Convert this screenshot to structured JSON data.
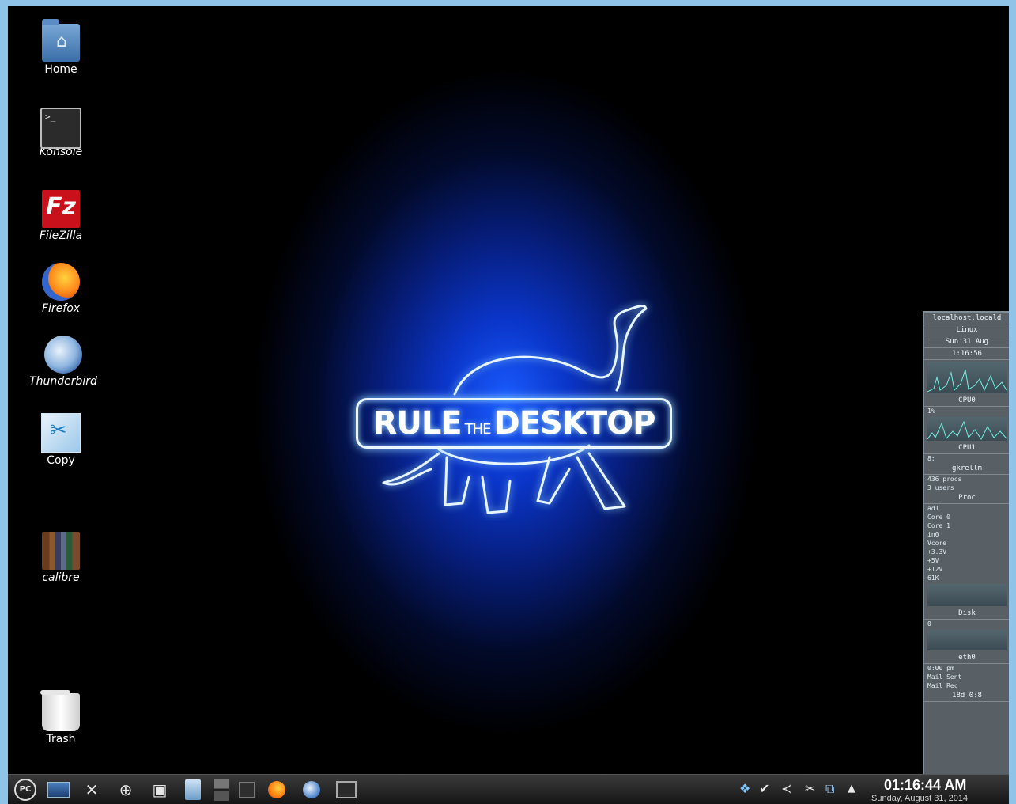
{
  "desktop_icons": [
    {
      "id": "home",
      "label": "Home",
      "icon": "home-folder-icon"
    },
    {
      "id": "konsole",
      "label": "Konsole",
      "icon": "terminal-icon"
    },
    {
      "id": "filezilla",
      "label": "FileZilla",
      "icon": "filezilla-icon"
    },
    {
      "id": "firefox",
      "label": "Firefox",
      "icon": "firefox-icon"
    },
    {
      "id": "thunderbird",
      "label": "Thunderbird",
      "icon": "thunderbird-icon"
    },
    {
      "id": "copy",
      "label": "Copy",
      "icon": "copy-app-icon"
    },
    {
      "id": "calibre",
      "label": "calibre",
      "icon": "calibre-icon"
    },
    {
      "id": "trash",
      "label": "Trash",
      "icon": "trash-icon"
    }
  ],
  "wallpaper": {
    "logo_big1": "RULE",
    "logo_small": "THE",
    "logo_big2": "DESKTOP",
    "accent_color": "#1a5cff"
  },
  "conky": {
    "host": "localhost.locald",
    "os": "Linux",
    "date": "Sun 31 Aug",
    "time": "1:16:56",
    "cpu0_label": "CPU0",
    "cpu1_pct": "1%",
    "cpu1_label": "CPU1",
    "mem": "8:",
    "mem_label": "gkrellm",
    "procs": "436 procs",
    "procs_sub": "3 users",
    "proc_label": "Proc",
    "sensors_a": [
      "ad1",
      "Core 0",
      "Core 1"
    ],
    "sensors_b": [
      "in0",
      "Vcore",
      "+3.3V",
      "+5V",
      "+12V"
    ],
    "disk_val": "61K",
    "disk_label": "Disk",
    "net_val": "0",
    "net_label": "eth0",
    "uptime_a": "0:00 pm",
    "mail_a": "Mail Sent",
    "mail_b": "Mail Rec",
    "footer": "18d 0:8"
  },
  "taskbar": {
    "clock_time": "01:16:44 AM",
    "clock_date": "Sunday, August 31, 2014",
    "launchers": [
      "pclinuxos-menu-icon",
      "desktop-icon",
      "settings-tools-icon",
      "network-icon",
      "package-manager-icon",
      "file-manager-icon",
      "pager-icon",
      "terminal-task-icon",
      "firefox-task-icon",
      "thunderbird-task-icon",
      "konsole-task-icon"
    ],
    "tray": [
      "dropbox-icon",
      "checkmark-icon",
      "network-tray-icon",
      "tools-tray-icon",
      "update-tray-icon",
      "tray-expand-icon"
    ]
  }
}
